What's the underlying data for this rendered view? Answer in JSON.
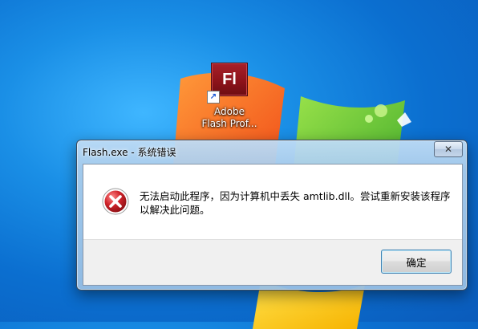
{
  "desktop": {
    "icon_label": "Adobe\nFlash Prof...",
    "icon_glyph": "Fl",
    "shortcut_arrow": "↗"
  },
  "dialog": {
    "title": "Flash.exe - 系统错误",
    "close_glyph": "✕",
    "message_line1": "无法启动此程序，因为计算机中丢失 amtlib.dll。尝试重新安装该程序",
    "message_line2": "以解决此问题。",
    "ok_label": "确定"
  },
  "colors": {
    "error_red": "#d0242b",
    "desktop_blue": "#0b6fd0",
    "flash_red": "#8b1219"
  }
}
